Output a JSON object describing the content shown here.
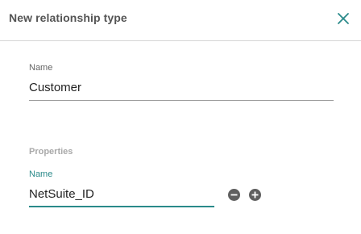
{
  "dialog": {
    "title": "New relationship type",
    "close_icon": "close-icon",
    "accent_color": "#2a8a8a"
  },
  "name_field": {
    "label": "Name",
    "value": "Customer"
  },
  "properties": {
    "section_label": "Properties",
    "items": [
      {
        "label": "Name",
        "value": "NetSuite_ID",
        "remove_icon": "minus-circle-icon",
        "add_icon": "plus-circle-icon"
      }
    ]
  }
}
